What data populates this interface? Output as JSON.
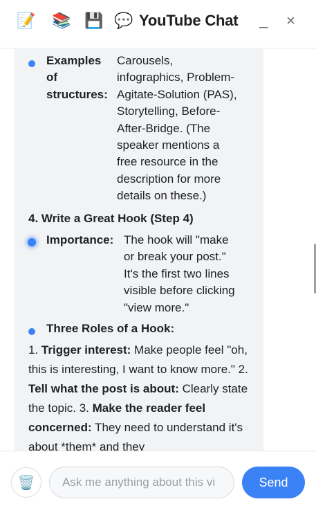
{
  "header": {
    "title": "YouTube Chat",
    "icons": [
      "memo-icon",
      "books-icon",
      "floppy-disk-icon",
      "speech-bubble-icon"
    ],
    "minimize_label": "_",
    "close_label": "×"
  },
  "chat": {
    "structures": {
      "label_lines": [
        "Examples",
        "of",
        "structures:"
      ],
      "value_lines": [
        "Carousels,",
        "infographics, Problem-",
        "Agitate-Solution (PAS),",
        "Storytelling, Before-",
        "After-Bridge. (The",
        "speaker mentions a",
        "free resource in the",
        "description for more",
        "details on these.)"
      ]
    },
    "step4_heading": "4. Write a Great Hook (Step 4)",
    "importance": {
      "label": "Importance:",
      "value_lines": [
        "The hook will \"make",
        "or break your post.\"",
        "It's the first two lines",
        "visible before clicking",
        "\"view more.\""
      ]
    },
    "roles_heading": "Three Roles of a Hook:",
    "roles_paragraph": {
      "p1_prefix": "1. ",
      "p1_bold": "Trigger interest:",
      "p1_text": " Make people feel \"oh, this is interesting, I want to know more.\" 2. ",
      "p2_bold": "Tell what the post is about:",
      "p2_text": " Clearly state the topic. 3. ",
      "p3_bold": "Make the reader feel concerned:",
      "p3_text": " They need to understand it's about *them* and they"
    }
  },
  "footer": {
    "input_placeholder": "Ask me anything about this vi",
    "send_label": "Send"
  },
  "colors": {
    "accent": "#3b82f6",
    "bubble": "#f2f3f5"
  }
}
